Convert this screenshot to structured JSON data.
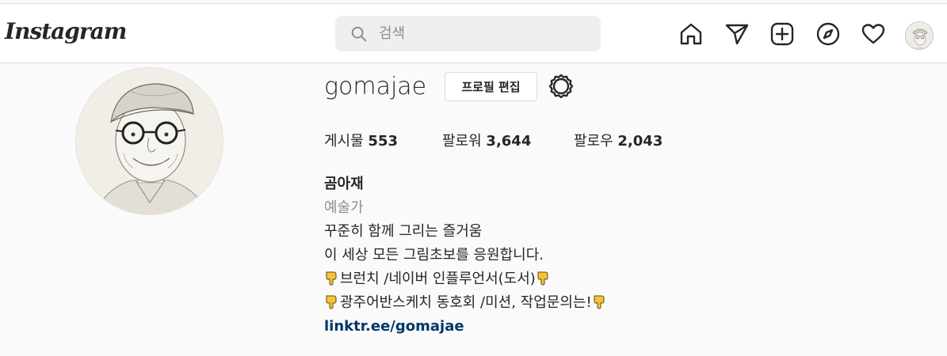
{
  "header": {
    "logo": "Instagram",
    "search": {
      "placeholder": "검색"
    },
    "icons": [
      "home-icon",
      "direct-message-icon",
      "new-post-icon",
      "explore-icon",
      "activity-heart-icon",
      "profile-avatar"
    ]
  },
  "profile": {
    "username": "gomajae",
    "edit_button": "프로필 편집",
    "stats": [
      {
        "label": "게시물",
        "value": "553"
      },
      {
        "label": "팔로워",
        "value": "3,644"
      },
      {
        "label": "팔로우",
        "value": "2,043"
      }
    ],
    "bio": {
      "name": "곰아재",
      "category": "예술가",
      "line1": "꾸준히 함께 그리는 즐거움",
      "line2": "이 세상 모든 그림초보를 응원합니다.",
      "line3": "브런치 /네이버 인플루언서(도서)",
      "line4": "광주어반스케치 동호회 /미션, 작업문의는!",
      "emoji": "pointing-down-hand-emoji",
      "link": "linktr.ee/gomajae"
    }
  },
  "colors": {
    "accent_link": "#00376b",
    "background": "#fafafa",
    "muted": "#8e8e8e"
  }
}
